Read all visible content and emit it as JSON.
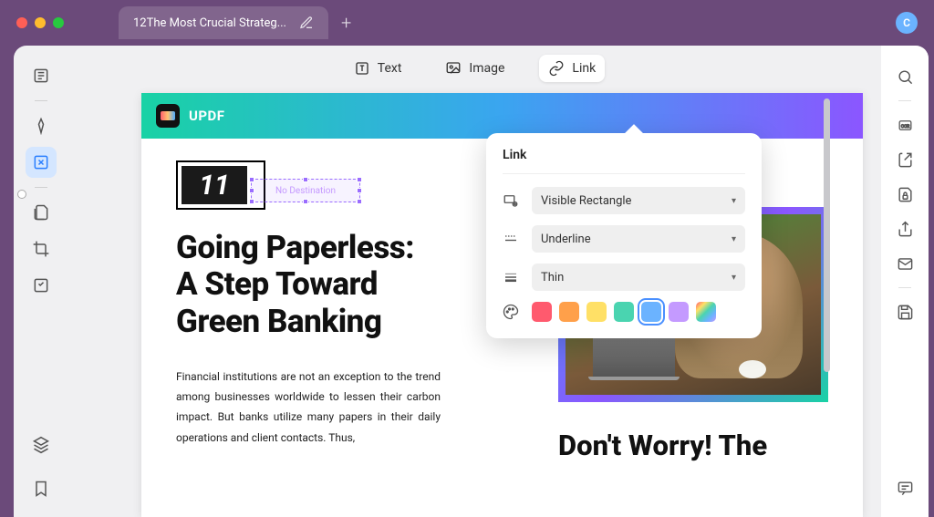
{
  "titlebar": {
    "tab_title": "12The Most Crucial Strateg...",
    "avatar_letter": "C"
  },
  "top_tools": {
    "text": "Text",
    "image": "Image",
    "link": "Link"
  },
  "link_popup": {
    "title": "Link",
    "visibility": "Visible Rectangle",
    "style": "Underline",
    "thickness": "Thin"
  },
  "document": {
    "brand": "UPDF",
    "page_number": "11",
    "link_placeholder": "No Destination",
    "title_line1": "Going Paperless:",
    "title_line2": "A Step Toward",
    "title_line3": "Green Banking",
    "body": "Financial institutions are not an exception to the trend among businesses worldwide to lessen their carbon impact. But banks utilize many papers in their daily operations and client contacts. Thus,",
    "subtitle": "Don't Worry! The"
  }
}
